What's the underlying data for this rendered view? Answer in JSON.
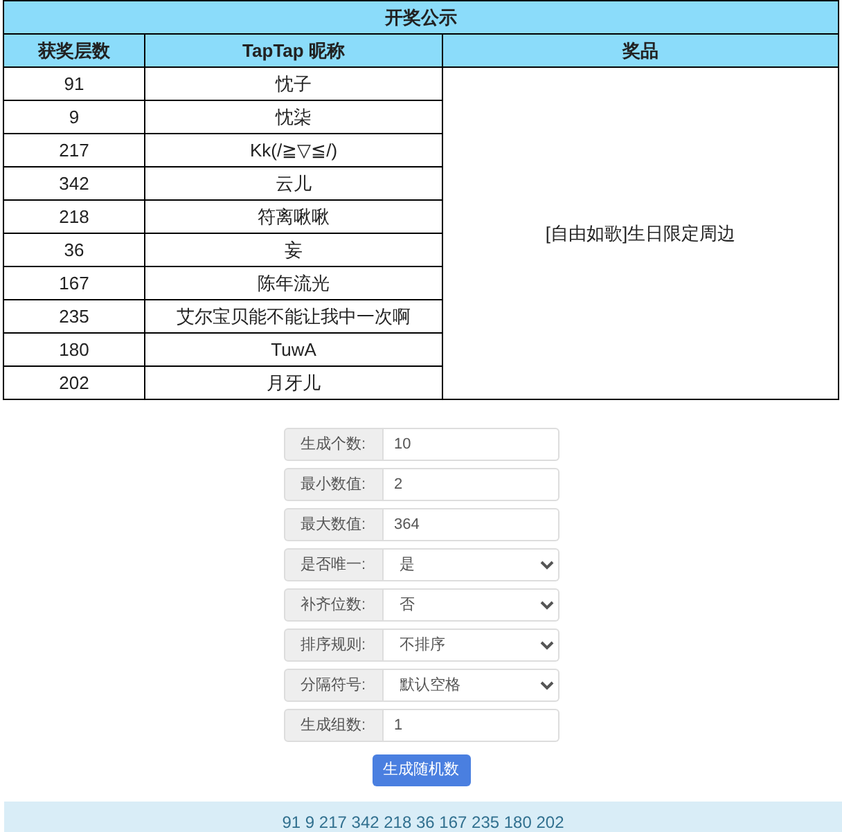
{
  "table": {
    "title": "开奖公示",
    "columns": [
      "获奖层数",
      "TapTap 昵称",
      "奖品"
    ],
    "rows": [
      {
        "floor": "91",
        "nickname": "忱子"
      },
      {
        "floor": "9",
        "nickname": "忱柒"
      },
      {
        "floor": "217",
        "nickname": "Kk(/≧▽≦/)"
      },
      {
        "floor": "342",
        "nickname": "云儿"
      },
      {
        "floor": "218",
        "nickname": "符离啾啾"
      },
      {
        "floor": "36",
        "nickname": "妄"
      },
      {
        "floor": "167",
        "nickname": "陈年流光"
      },
      {
        "floor": "235",
        "nickname": "艾尔宝贝能不能让我中一次啊"
      },
      {
        "floor": "180",
        "nickname": "TuwA"
      },
      {
        "floor": "202",
        "nickname": "月牙儿"
      }
    ],
    "prize": "[自由如歌]生日限定周边"
  },
  "form": {
    "fields": [
      {
        "label": "生成个数:",
        "kind": "input",
        "value": "10"
      },
      {
        "label": "最小数值:",
        "kind": "input",
        "value": "2"
      },
      {
        "label": "最大数值:",
        "kind": "input",
        "value": "364"
      },
      {
        "label": "是否唯一:",
        "kind": "select",
        "value": "是"
      },
      {
        "label": "补齐位数:",
        "kind": "select",
        "value": "否"
      },
      {
        "label": "排序规则:",
        "kind": "select",
        "value": "不排序"
      },
      {
        "label": "分隔符号:",
        "kind": "select",
        "value": "默认空格"
      },
      {
        "label": "生成组数:",
        "kind": "input",
        "value": "1"
      }
    ],
    "button": "生成随机数"
  },
  "result": "91 9 217 342 218 36 167 235 180 202"
}
